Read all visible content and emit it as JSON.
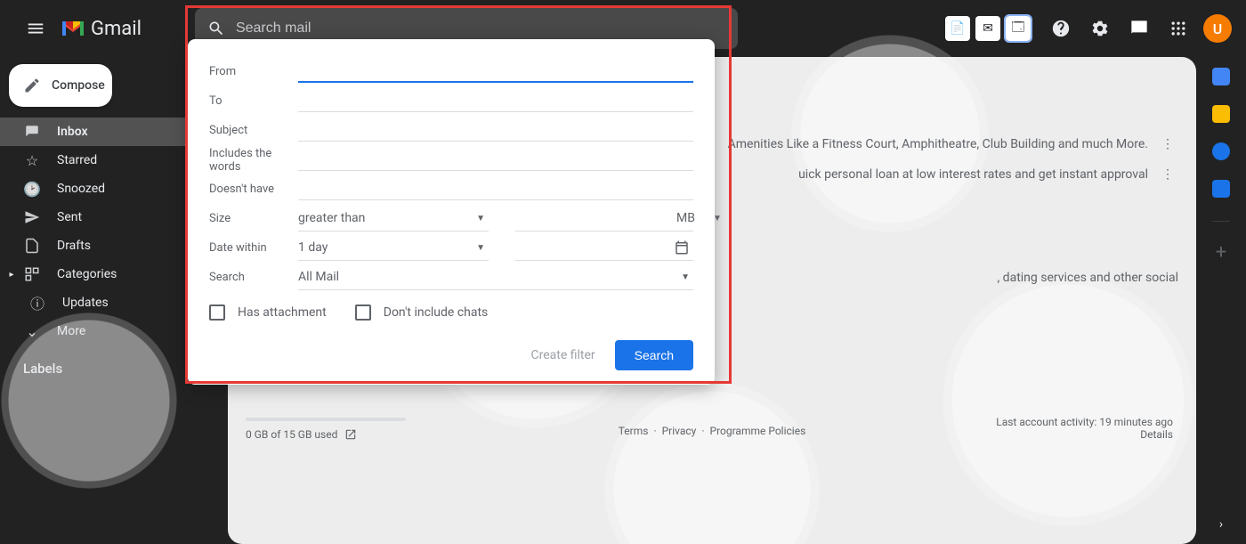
{
  "header": {
    "product": "Gmail",
    "search_placeholder": "Search mail",
    "avatar_initial": "U"
  },
  "compose_label": "Compose",
  "nav": {
    "inbox": "Inbox",
    "starred": "Starred",
    "snoozed": "Snoozed",
    "sent": "Sent",
    "drafts": "Drafts",
    "categories": "Categories",
    "updates": "Updates",
    "more": "More"
  },
  "labels_header": "Labels",
  "adv": {
    "from": "From",
    "to": "To",
    "subject": "Subject",
    "includes": "Includes the words",
    "doesnt": "Doesn't have",
    "size": "Size",
    "size_op": "greater than",
    "size_unit": "MB",
    "date_within": "Date within",
    "date_range": "1 day",
    "search": "Search",
    "search_in": "All Mail",
    "has_attachment": "Has attachment",
    "no_chats": "Don't include chats",
    "create_filter": "Create filter",
    "search_btn": "Search"
  },
  "rows": {
    "r1": "Amenities Like a Fitness Court, Amphitheatre, Club Building and much More.",
    "r2": "uick personal loan at low interest rates and get instant approval",
    "r3": ", dating services and other social"
  },
  "footer": {
    "terms": "Terms",
    "privacy": "Privacy",
    "policies": "Programme Policies",
    "sep": "·"
  },
  "activity": {
    "line": "Last account activity: 19 minutes ago",
    "details": "Details"
  },
  "storage": "0 GB of 15 GB used"
}
